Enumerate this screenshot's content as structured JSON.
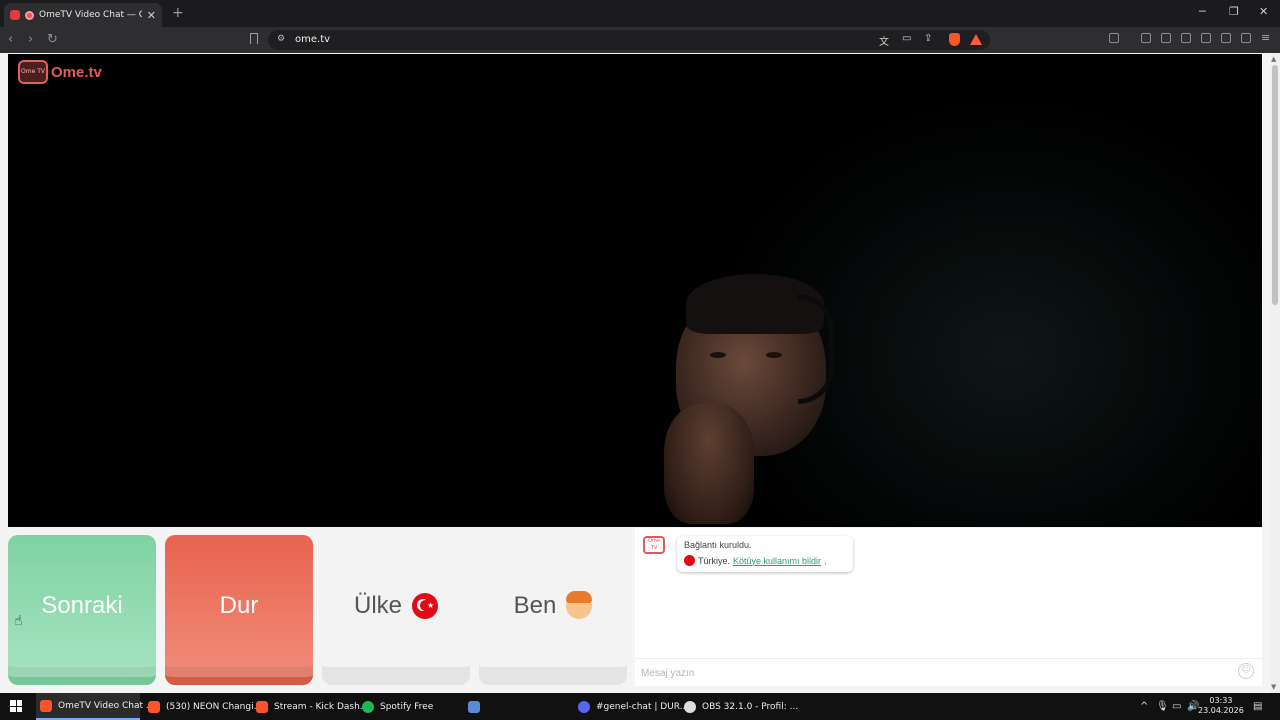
{
  "browser": {
    "tab_title": "OmeTV Video Chat — Omeg",
    "tab_close": "✕",
    "new_tab": "+",
    "url": "ome.tv",
    "window_controls": {
      "minimize": "─",
      "restore": "❐",
      "close": "✕"
    }
  },
  "site": {
    "logo_text": "Ome.tv",
    "logo_badge": "Ome TV"
  },
  "controls": {
    "next_label": "Sonraki",
    "stop_label": "Dur",
    "country_label": "Ülke",
    "me_label": "Ben"
  },
  "chat": {
    "bot_avatar": "Ome TV",
    "connected": "Bağlantı kuruldu.",
    "country": "Türkiye.",
    "report_link": "Kötüye kullanımı bildir",
    "report_suffix": ".",
    "input_placeholder": "Mesaj yazın"
  },
  "taskbar": {
    "items": [
      {
        "label": "OmeTV Video Chat ...",
        "icon": "brave-icon",
        "color": "#fb542b"
      },
      {
        "label": "(530) NEON Changi...",
        "icon": "brave-icon",
        "color": "#fb542b"
      },
      {
        "label": "Stream - Kick Dash...",
        "icon": "brave-icon",
        "color": "#fb542b"
      },
      {
        "label": "Spotify Free",
        "icon": "spotify-icon",
        "color": "#1db954"
      },
      {
        "label": "",
        "icon": "app-icon",
        "color": "#5b8bd6"
      },
      {
        "label": "#genel-chat | DUR...",
        "icon": "discord-icon",
        "color": "#5865f2"
      },
      {
        "label": "OBS 32.1.0 - Profil: ...",
        "icon": "obs-icon",
        "color": "#dddddd"
      }
    ],
    "time": "03:33",
    "date": "23.04.2026"
  },
  "colors": {
    "next": "#8fdab0",
    "stop": "#ec7561",
    "link": "#2e9e7b",
    "brand": "#e05a5a"
  }
}
